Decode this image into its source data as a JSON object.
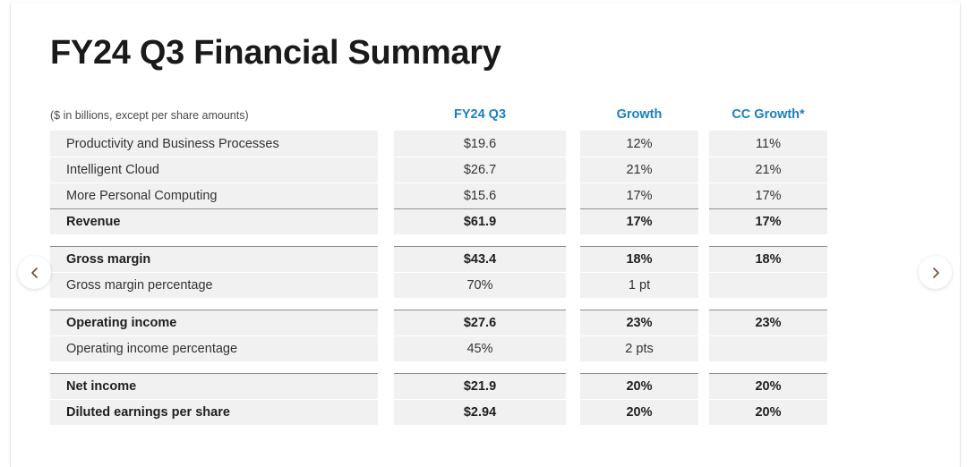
{
  "page": {
    "title": "FY24 Q3 Financial Summary",
    "subtitle": "($ in billions, except per share amounts)"
  },
  "columns": {
    "label": "",
    "c1": "FY24 Q3",
    "c2": "Growth",
    "c3": "CC Growth*"
  },
  "colors": {
    "header_blue": "#1a7fc1",
    "cell_background": "#f1f1f1",
    "total_rule": "#8c8c8c",
    "text": "#333333"
  },
  "nav": {
    "prev_label": "Previous",
    "next_label": "Next",
    "prev_icon": "chevron-left-icon",
    "next_icon": "chevron-right-icon"
  },
  "blocks": [
    {
      "id": "revenue",
      "rows": [
        {
          "label": "Productivity and Business Processes",
          "c1": "$19.6",
          "c2": "12%",
          "c3": "11%",
          "style": "normal"
        },
        {
          "label": "Intelligent Cloud",
          "c1": "$26.7",
          "c2": "21%",
          "c3": "21%",
          "style": "normal"
        },
        {
          "label": "More Personal Computing",
          "c1": "$15.6",
          "c2": "17%",
          "c3": "17%",
          "style": "normal"
        },
        {
          "label": "Revenue",
          "c1": "$61.9",
          "c2": "17%",
          "c3": "17%",
          "style": "total"
        }
      ]
    },
    {
      "id": "gross-margin",
      "rows": [
        {
          "label": "Gross margin",
          "c1": "$43.4",
          "c2": "18%",
          "c3": "18%",
          "style": "total"
        },
        {
          "label": "Gross margin percentage",
          "c1": "70%",
          "c2": "1 pt",
          "c3": "",
          "style": "normal"
        }
      ]
    },
    {
      "id": "operating-income",
      "rows": [
        {
          "label": "Operating income",
          "c1": "$27.6",
          "c2": "23%",
          "c3": "23%",
          "style": "total"
        },
        {
          "label": "Operating income percentage",
          "c1": "45%",
          "c2": "2 pts",
          "c3": "",
          "style": "normal"
        }
      ]
    },
    {
      "id": "net-income",
      "rows": [
        {
          "label": "Net income",
          "c1": "$21.9",
          "c2": "20%",
          "c3": "20%",
          "style": "total"
        },
        {
          "label": "Diluted earnings per share",
          "c1": "$2.94",
          "c2": "20%",
          "c3": "20%",
          "style": "strong"
        }
      ]
    }
  ]
}
